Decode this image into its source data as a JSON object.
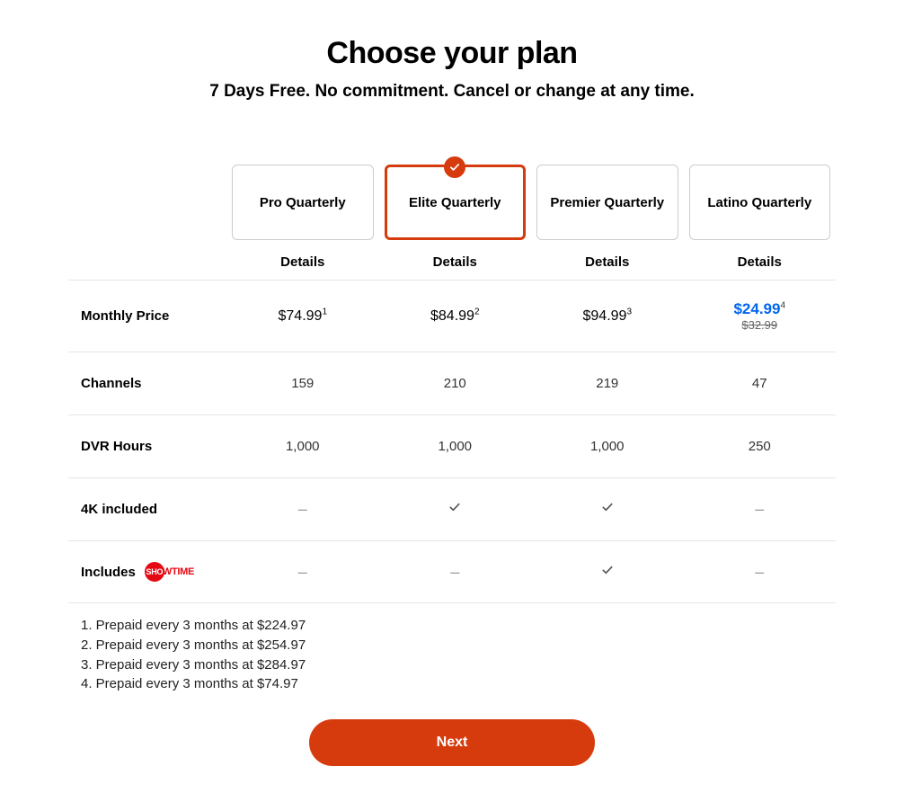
{
  "heading": "Choose your plan",
  "subheading": "7 Days Free. No commitment. Cancel or change at any time.",
  "details_label": "Details",
  "plans": [
    {
      "name": "Pro Quarterly",
      "selected": false
    },
    {
      "name": "Elite Quarterly",
      "selected": true
    },
    {
      "name": "Premier Quarterly",
      "selected": false
    },
    {
      "name": "Latino Quarterly",
      "selected": false
    }
  ],
  "rows": {
    "monthly_price": {
      "label": "Monthly Price",
      "values": [
        {
          "price": "$74.99",
          "sup": "1"
        },
        {
          "price": "$84.99",
          "sup": "2"
        },
        {
          "price": "$94.99",
          "sup": "3"
        },
        {
          "sale": "$24.99",
          "sup": "4",
          "old": "$32.99"
        }
      ]
    },
    "channels": {
      "label": "Channels",
      "values": [
        "159",
        "210",
        "219",
        "47"
      ]
    },
    "dvr": {
      "label": "DVR Hours",
      "values": [
        "1,000",
        "1,000",
        "1,000",
        "250"
      ]
    },
    "fourk": {
      "label": "4K included",
      "values": [
        "dash",
        "check",
        "check",
        "dash"
      ]
    },
    "includes": {
      "label": "Includes",
      "brand": "SHOWTIME",
      "values": [
        "dash",
        "dash",
        "check",
        "dash"
      ]
    }
  },
  "footnotes": [
    "1. Prepaid every 3 months at $224.97",
    "2. Prepaid every 3 months at $254.97",
    "3. Prepaid every 3 months at $284.97",
    "4. Prepaid every 3 months at $74.97"
  ],
  "next_label": "Next"
}
